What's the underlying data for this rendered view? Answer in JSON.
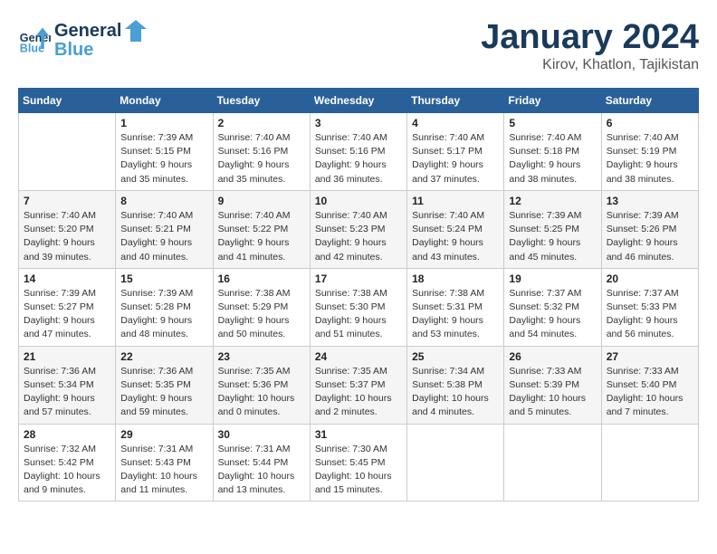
{
  "header": {
    "logo_line1": "General",
    "logo_line2": "Blue",
    "month": "January 2024",
    "location": "Kirov, Khatlon, Tajikistan"
  },
  "weekdays": [
    "Sunday",
    "Monday",
    "Tuesday",
    "Wednesday",
    "Thursday",
    "Friday",
    "Saturday"
  ],
  "weeks": [
    [
      {
        "day": "",
        "sunrise": "",
        "sunset": "",
        "daylight": ""
      },
      {
        "day": "1",
        "sunrise": "Sunrise: 7:39 AM",
        "sunset": "Sunset: 5:15 PM",
        "daylight": "Daylight: 9 hours and 35 minutes."
      },
      {
        "day": "2",
        "sunrise": "Sunrise: 7:40 AM",
        "sunset": "Sunset: 5:16 PM",
        "daylight": "Daylight: 9 hours and 35 minutes."
      },
      {
        "day": "3",
        "sunrise": "Sunrise: 7:40 AM",
        "sunset": "Sunset: 5:16 PM",
        "daylight": "Daylight: 9 hours and 36 minutes."
      },
      {
        "day": "4",
        "sunrise": "Sunrise: 7:40 AM",
        "sunset": "Sunset: 5:17 PM",
        "daylight": "Daylight: 9 hours and 37 minutes."
      },
      {
        "day": "5",
        "sunrise": "Sunrise: 7:40 AM",
        "sunset": "Sunset: 5:18 PM",
        "daylight": "Daylight: 9 hours and 38 minutes."
      },
      {
        "day": "6",
        "sunrise": "Sunrise: 7:40 AM",
        "sunset": "Sunset: 5:19 PM",
        "daylight": "Daylight: 9 hours and 38 minutes."
      }
    ],
    [
      {
        "day": "7",
        "sunrise": "Sunrise: 7:40 AM",
        "sunset": "Sunset: 5:20 PM",
        "daylight": "Daylight: 9 hours and 39 minutes."
      },
      {
        "day": "8",
        "sunrise": "Sunrise: 7:40 AM",
        "sunset": "Sunset: 5:21 PM",
        "daylight": "Daylight: 9 hours and 40 minutes."
      },
      {
        "day": "9",
        "sunrise": "Sunrise: 7:40 AM",
        "sunset": "Sunset: 5:22 PM",
        "daylight": "Daylight: 9 hours and 41 minutes."
      },
      {
        "day": "10",
        "sunrise": "Sunrise: 7:40 AM",
        "sunset": "Sunset: 5:23 PM",
        "daylight": "Daylight: 9 hours and 42 minutes."
      },
      {
        "day": "11",
        "sunrise": "Sunrise: 7:40 AM",
        "sunset": "Sunset: 5:24 PM",
        "daylight": "Daylight: 9 hours and 43 minutes."
      },
      {
        "day": "12",
        "sunrise": "Sunrise: 7:39 AM",
        "sunset": "Sunset: 5:25 PM",
        "daylight": "Daylight: 9 hours and 45 minutes."
      },
      {
        "day": "13",
        "sunrise": "Sunrise: 7:39 AM",
        "sunset": "Sunset: 5:26 PM",
        "daylight": "Daylight: 9 hours and 46 minutes."
      }
    ],
    [
      {
        "day": "14",
        "sunrise": "Sunrise: 7:39 AM",
        "sunset": "Sunset: 5:27 PM",
        "daylight": "Daylight: 9 hours and 47 minutes."
      },
      {
        "day": "15",
        "sunrise": "Sunrise: 7:39 AM",
        "sunset": "Sunset: 5:28 PM",
        "daylight": "Daylight: 9 hours and 48 minutes."
      },
      {
        "day": "16",
        "sunrise": "Sunrise: 7:38 AM",
        "sunset": "Sunset: 5:29 PM",
        "daylight": "Daylight: 9 hours and 50 minutes."
      },
      {
        "day": "17",
        "sunrise": "Sunrise: 7:38 AM",
        "sunset": "Sunset: 5:30 PM",
        "daylight": "Daylight: 9 hours and 51 minutes."
      },
      {
        "day": "18",
        "sunrise": "Sunrise: 7:38 AM",
        "sunset": "Sunset: 5:31 PM",
        "daylight": "Daylight: 9 hours and 53 minutes."
      },
      {
        "day": "19",
        "sunrise": "Sunrise: 7:37 AM",
        "sunset": "Sunset: 5:32 PM",
        "daylight": "Daylight: 9 hours and 54 minutes."
      },
      {
        "day": "20",
        "sunrise": "Sunrise: 7:37 AM",
        "sunset": "Sunset: 5:33 PM",
        "daylight": "Daylight: 9 hours and 56 minutes."
      }
    ],
    [
      {
        "day": "21",
        "sunrise": "Sunrise: 7:36 AM",
        "sunset": "Sunset: 5:34 PM",
        "daylight": "Daylight: 9 hours and 57 minutes."
      },
      {
        "day": "22",
        "sunrise": "Sunrise: 7:36 AM",
        "sunset": "Sunset: 5:35 PM",
        "daylight": "Daylight: 9 hours and 59 minutes."
      },
      {
        "day": "23",
        "sunrise": "Sunrise: 7:35 AM",
        "sunset": "Sunset: 5:36 PM",
        "daylight": "Daylight: 10 hours and 0 minutes."
      },
      {
        "day": "24",
        "sunrise": "Sunrise: 7:35 AM",
        "sunset": "Sunset: 5:37 PM",
        "daylight": "Daylight: 10 hours and 2 minutes."
      },
      {
        "day": "25",
        "sunrise": "Sunrise: 7:34 AM",
        "sunset": "Sunset: 5:38 PM",
        "daylight": "Daylight: 10 hours and 4 minutes."
      },
      {
        "day": "26",
        "sunrise": "Sunrise: 7:33 AM",
        "sunset": "Sunset: 5:39 PM",
        "daylight": "Daylight: 10 hours and 5 minutes."
      },
      {
        "day": "27",
        "sunrise": "Sunrise: 7:33 AM",
        "sunset": "Sunset: 5:40 PM",
        "daylight": "Daylight: 10 hours and 7 minutes."
      }
    ],
    [
      {
        "day": "28",
        "sunrise": "Sunrise: 7:32 AM",
        "sunset": "Sunset: 5:42 PM",
        "daylight": "Daylight: 10 hours and 9 minutes."
      },
      {
        "day": "29",
        "sunrise": "Sunrise: 7:31 AM",
        "sunset": "Sunset: 5:43 PM",
        "daylight": "Daylight: 10 hours and 11 minutes."
      },
      {
        "day": "30",
        "sunrise": "Sunrise: 7:31 AM",
        "sunset": "Sunset: 5:44 PM",
        "daylight": "Daylight: 10 hours and 13 minutes."
      },
      {
        "day": "31",
        "sunrise": "Sunrise: 7:30 AM",
        "sunset": "Sunset: 5:45 PM",
        "daylight": "Daylight: 10 hours and 15 minutes."
      },
      {
        "day": "",
        "sunrise": "",
        "sunset": "",
        "daylight": ""
      },
      {
        "day": "",
        "sunrise": "",
        "sunset": "",
        "daylight": ""
      },
      {
        "day": "",
        "sunrise": "",
        "sunset": "",
        "daylight": ""
      }
    ]
  ]
}
